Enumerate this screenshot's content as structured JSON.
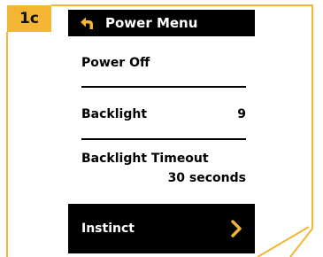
{
  "step_label": "1c",
  "accent_color": "#f2b632",
  "header": {
    "title": "Power Menu",
    "back_icon": "back-arrow-icon"
  },
  "menu": {
    "power_off": {
      "label": "Power Off"
    },
    "backlight": {
      "label": "Backlight",
      "value": "9"
    },
    "backlight_timeout": {
      "label": "Backlight Timeout",
      "value": "30 seconds"
    },
    "instinct": {
      "label": "Instinct",
      "icon": "chevron-right-icon",
      "selected": true
    }
  }
}
